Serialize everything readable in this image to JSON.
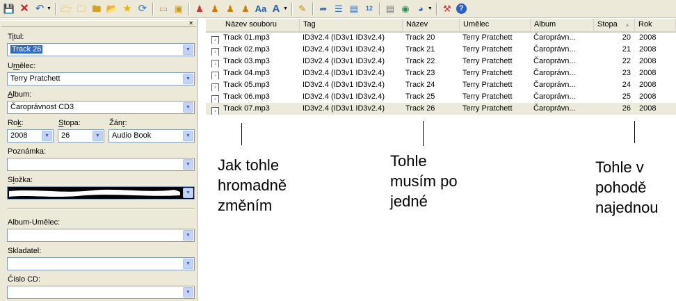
{
  "toolbar": {
    "icons": [
      "save-icon",
      "delete-icon",
      "undo-icon",
      "open-folder-icon",
      "add-folder-icon",
      "folder-icon",
      "open-icon",
      "favorite-star-icon",
      "refresh-icon",
      "select-all-icon",
      "invert-selection-icon",
      "tag-from-filename-icon",
      "filename-from-tag-icon",
      "filename-from-filename-icon",
      "tag-from-tag-icon",
      "autonumber-icon",
      "text-case-icon",
      "edit-icon",
      "export-icon",
      "playlist-icon",
      "text-file-icon",
      "numbering-icon",
      "scanner-icon",
      "web-sources-icon",
      "actions-icon",
      "tools-icon",
      "help-icon"
    ]
  },
  "fields": {
    "title": {
      "label_pre": "T",
      "label_u": "i",
      "label_post": "tul:",
      "value": "Track 26"
    },
    "artist": {
      "label_pre": "U",
      "label_u": "m",
      "label_post": "ělec:",
      "value": "Terry Pratchett"
    },
    "album": {
      "label_pre": "",
      "label_u": "A",
      "label_post": "lbum:",
      "value": "Čaroprávnost CD3"
    },
    "year": {
      "label_pre": "Ro",
      "label_u": "k",
      "label_post": ":",
      "value": "2008"
    },
    "track": {
      "label_pre": "",
      "label_u": "S",
      "label_post": "topa:",
      "value": "26"
    },
    "genre": {
      "label_pre": "Žán",
      "label_u": "r",
      "label_post": ":",
      "value": "Audio Book"
    },
    "comment": {
      "label_pre": "Poznámka:",
      "label_u": "",
      "label_post": "",
      "value": ""
    },
    "folder": {
      "label_pre": "S",
      "label_u": "l",
      "label_post": "ožka:",
      "value": ""
    },
    "album_artist": {
      "label_pre": "Album-Umělec:",
      "label_u": "",
      "label_post": "",
      "value": ""
    },
    "composer": {
      "label_pre": "Skladatel:",
      "label_u": "",
      "label_post": "",
      "value": ""
    },
    "disc": {
      "label_pre": "Číslo CD:",
      "label_u": "",
      "label_post": "",
      "value": ""
    }
  },
  "grid": {
    "columns": [
      "Název souboru",
      "Tag",
      "Název",
      "Umělec",
      "Album",
      "Stopa",
      "Rok"
    ],
    "sort_indicator": "▲",
    "rows": [
      {
        "file": "Track 01.mp3",
        "tag": "ID3v2.4 (ID3v1 ID3v2.4)",
        "title": "Track 20",
        "artist": "Terry Pratchett",
        "album": "Čaroprávn...",
        "track": "20",
        "year": "2008"
      },
      {
        "file": "Track 02.mp3",
        "tag": "ID3v2.4 (ID3v1 ID3v2.4)",
        "title": "Track 21",
        "artist": "Terry Pratchett",
        "album": "Čaroprávn...",
        "track": "21",
        "year": "2008"
      },
      {
        "file": "Track 03.mp3",
        "tag": "ID3v2.4 (ID3v1 ID3v2.4)",
        "title": "Track 22",
        "artist": "Terry Pratchett",
        "album": "Čaroprávn...",
        "track": "22",
        "year": "2008"
      },
      {
        "file": "Track 04.mp3",
        "tag": "ID3v2.4 (ID3v1 ID3v2.4)",
        "title": "Track 23",
        "artist": "Terry Pratchett",
        "album": "Čaroprávn...",
        "track": "23",
        "year": "2008"
      },
      {
        "file": "Track 05.mp3",
        "tag": "ID3v2.4 (ID3v1 ID3v2.4)",
        "title": "Track 24",
        "artist": "Terry Pratchett",
        "album": "Čaroprávn...",
        "track": "24",
        "year": "2008"
      },
      {
        "file": "Track 06.mp3",
        "tag": "ID3v2.4 (ID3v1 ID3v2.4)",
        "title": "Track 25",
        "artist": "Terry Pratchett",
        "album": "Čaroprávn...",
        "track": "25",
        "year": "2008"
      },
      {
        "file": "Track 07.mp3",
        "tag": "ID3v2.4 (ID3v1 ID3v2.4)",
        "title": "Track 26",
        "artist": "Terry Pratchett",
        "album": "Čaroprávn...",
        "track": "26",
        "year": "2008"
      }
    ]
  },
  "annotations": {
    "left": "Jak tohle\nhromadně\nzměním",
    "middle": "Tohle\nmusím po\njedné",
    "right": "Tohle v\npohodě\nnajednou"
  }
}
